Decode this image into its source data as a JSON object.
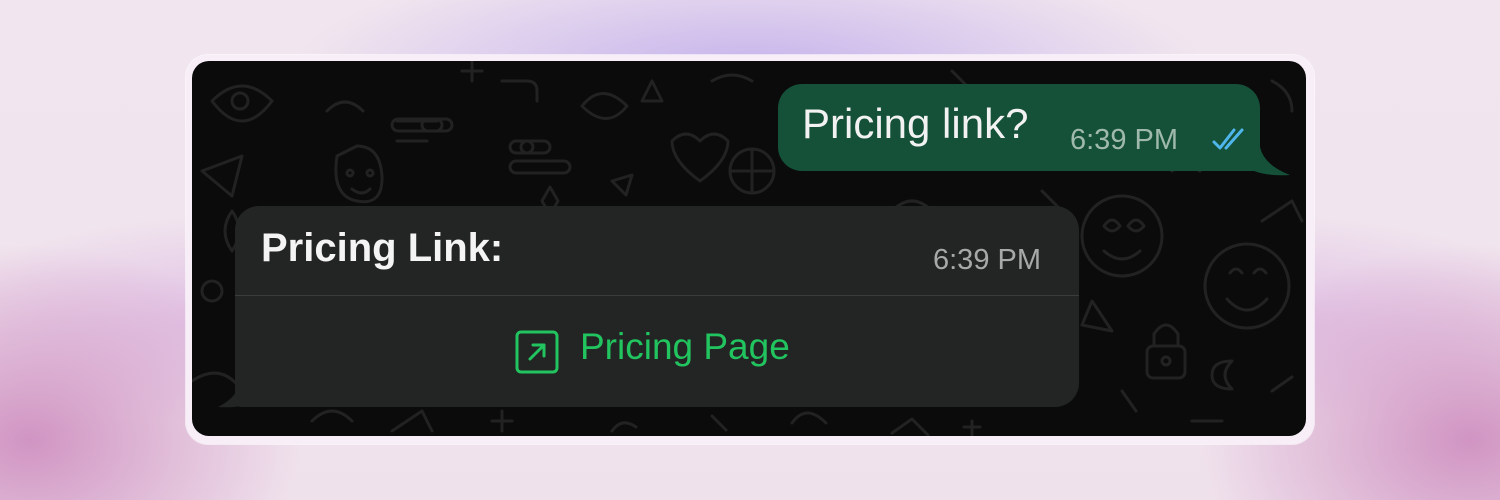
{
  "colors": {
    "chat_background": "#0b0b0b",
    "outgoing_bubble": "#155038",
    "incoming_bubble": "#232525",
    "link_green": "#21c45e",
    "read_ticks": "#4fb6ec"
  },
  "outgoing_message": {
    "text": "Pricing link?",
    "time": "6:39 PM",
    "status_icon": "double-check-read-icon"
  },
  "incoming_message": {
    "title": "Pricing Link:",
    "time": "6:39 PM",
    "link_button": {
      "icon": "external-link-icon",
      "label": "Pricing Page"
    }
  }
}
